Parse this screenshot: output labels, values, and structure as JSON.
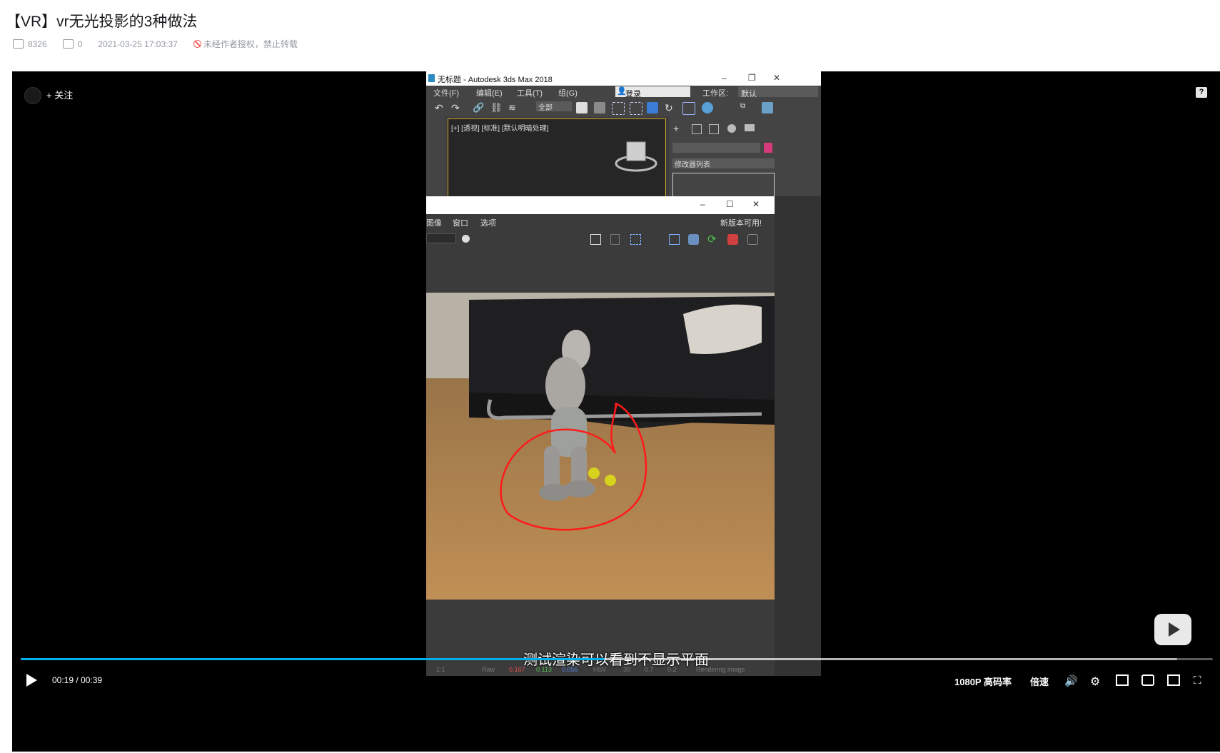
{
  "page": {
    "title": "【VR】vr无光投影的3种做法",
    "views": "8326",
    "comments": "0",
    "datetime": "2021-03-25 17:03:37",
    "copyright": "未经作者授权，禁止转载"
  },
  "player": {
    "follow_label": "+ 关注",
    "help_icon": "?",
    "subtitle": "测试渲染可以看到不显示平面",
    "time_current": "00:19",
    "time_sep": "/",
    "time_total": "00:39",
    "progress": 0.49,
    "buffered": 0.97,
    "quality": "1080P 高码率",
    "speed": "倍速",
    "accent": "#00aeec"
  },
  "app": {
    "window_title": "无标题 - Autodesk 3ds Max 2018",
    "menu": [
      "文件(F)",
      "编辑(E)",
      "工具(T)",
      "组(G)"
    ],
    "login": "登录",
    "workspace_label": "工作区:",
    "workspace_value": "默认",
    "select_filter": "全部",
    "viewport_label": "[+] [透视] [标准] [默认明暗处理]",
    "modifier_list": "修改器列表",
    "vfb_menu": [
      "图像",
      "窗口",
      "选项"
    ],
    "vfb_notice": "新版本可用!",
    "vfb_status": {
      "ratio": "1:1",
      "raw": "Raw",
      "r": "0.167",
      "g": "0.113",
      "b": "0.056",
      "mode": "HSV",
      "v1": "30",
      "v2": "0.7",
      "v3": "0.2",
      "info": "Rendering image"
    }
  }
}
